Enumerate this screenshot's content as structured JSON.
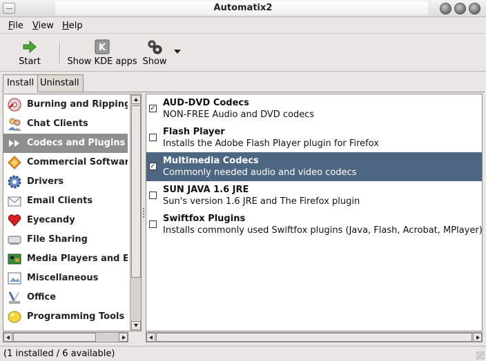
{
  "window": {
    "title": "Automatix2"
  },
  "menu": {
    "file": {
      "mnemonic": "F",
      "rest": "ile"
    },
    "view": {
      "mnemonic": "V",
      "rest": "iew"
    },
    "help": {
      "mnemonic": "H",
      "rest": "elp"
    }
  },
  "toolbar": {
    "start_label": "Start",
    "kde_label": "Show KDE apps",
    "show_label": "Show"
  },
  "tabs": [
    {
      "label": "Install",
      "active": true
    },
    {
      "label": "Uninstall",
      "active": false
    }
  ],
  "categories": [
    {
      "label": "Burning and Ripping",
      "icon": "disc-burn-icon"
    },
    {
      "label": "Chat Clients",
      "icon": "chat-people-icon"
    },
    {
      "label": "Codecs and Plugins",
      "icon": "fast-forward-icon",
      "selected": true
    },
    {
      "label": "Commercial Software",
      "icon": "diamond-icon"
    },
    {
      "label": "Drivers",
      "icon": "gear-icon"
    },
    {
      "label": "Email Clients",
      "icon": "envelope-icon"
    },
    {
      "label": "Eyecandy",
      "icon": "heart-icon"
    },
    {
      "label": "File Sharing",
      "icon": "drive-icon"
    },
    {
      "label": "Media Players and Editors",
      "icon": "circuit-board-icon"
    },
    {
      "label": "Miscellaneous",
      "icon": "picture-icon"
    },
    {
      "label": "Office",
      "icon": "office-tools-icon"
    },
    {
      "label": "Programming Tools",
      "icon": "bulb-icon"
    }
  ],
  "packages": [
    {
      "name": "AUD-DVD Codecs",
      "desc": "NON-FREE Audio and DVD codecs",
      "checked": true
    },
    {
      "name": "Flash Player",
      "desc": "Installs the Adobe Flash Player plugin for Firefox",
      "checked": false
    },
    {
      "name": "Multimedia Codecs",
      "desc": "Commonly needed audio and video codecs",
      "checked": true,
      "selected": true
    },
    {
      "name": "SUN JAVA 1.6 JRE",
      "desc": "Sun's version 1.6 JRE and The Firefox plugin",
      "checked": false
    },
    {
      "name": "Swiftfox Plugins",
      "desc": "Installs commonly used Swiftfox plugins (Java, Flash, Acrobat, MPlayer), M",
      "checked": false
    }
  ],
  "status": {
    "text": "(1 installed / 6 available)"
  },
  "colors": {
    "selection_left": "#8f8f8c",
    "selection_right": "#4d6782"
  }
}
